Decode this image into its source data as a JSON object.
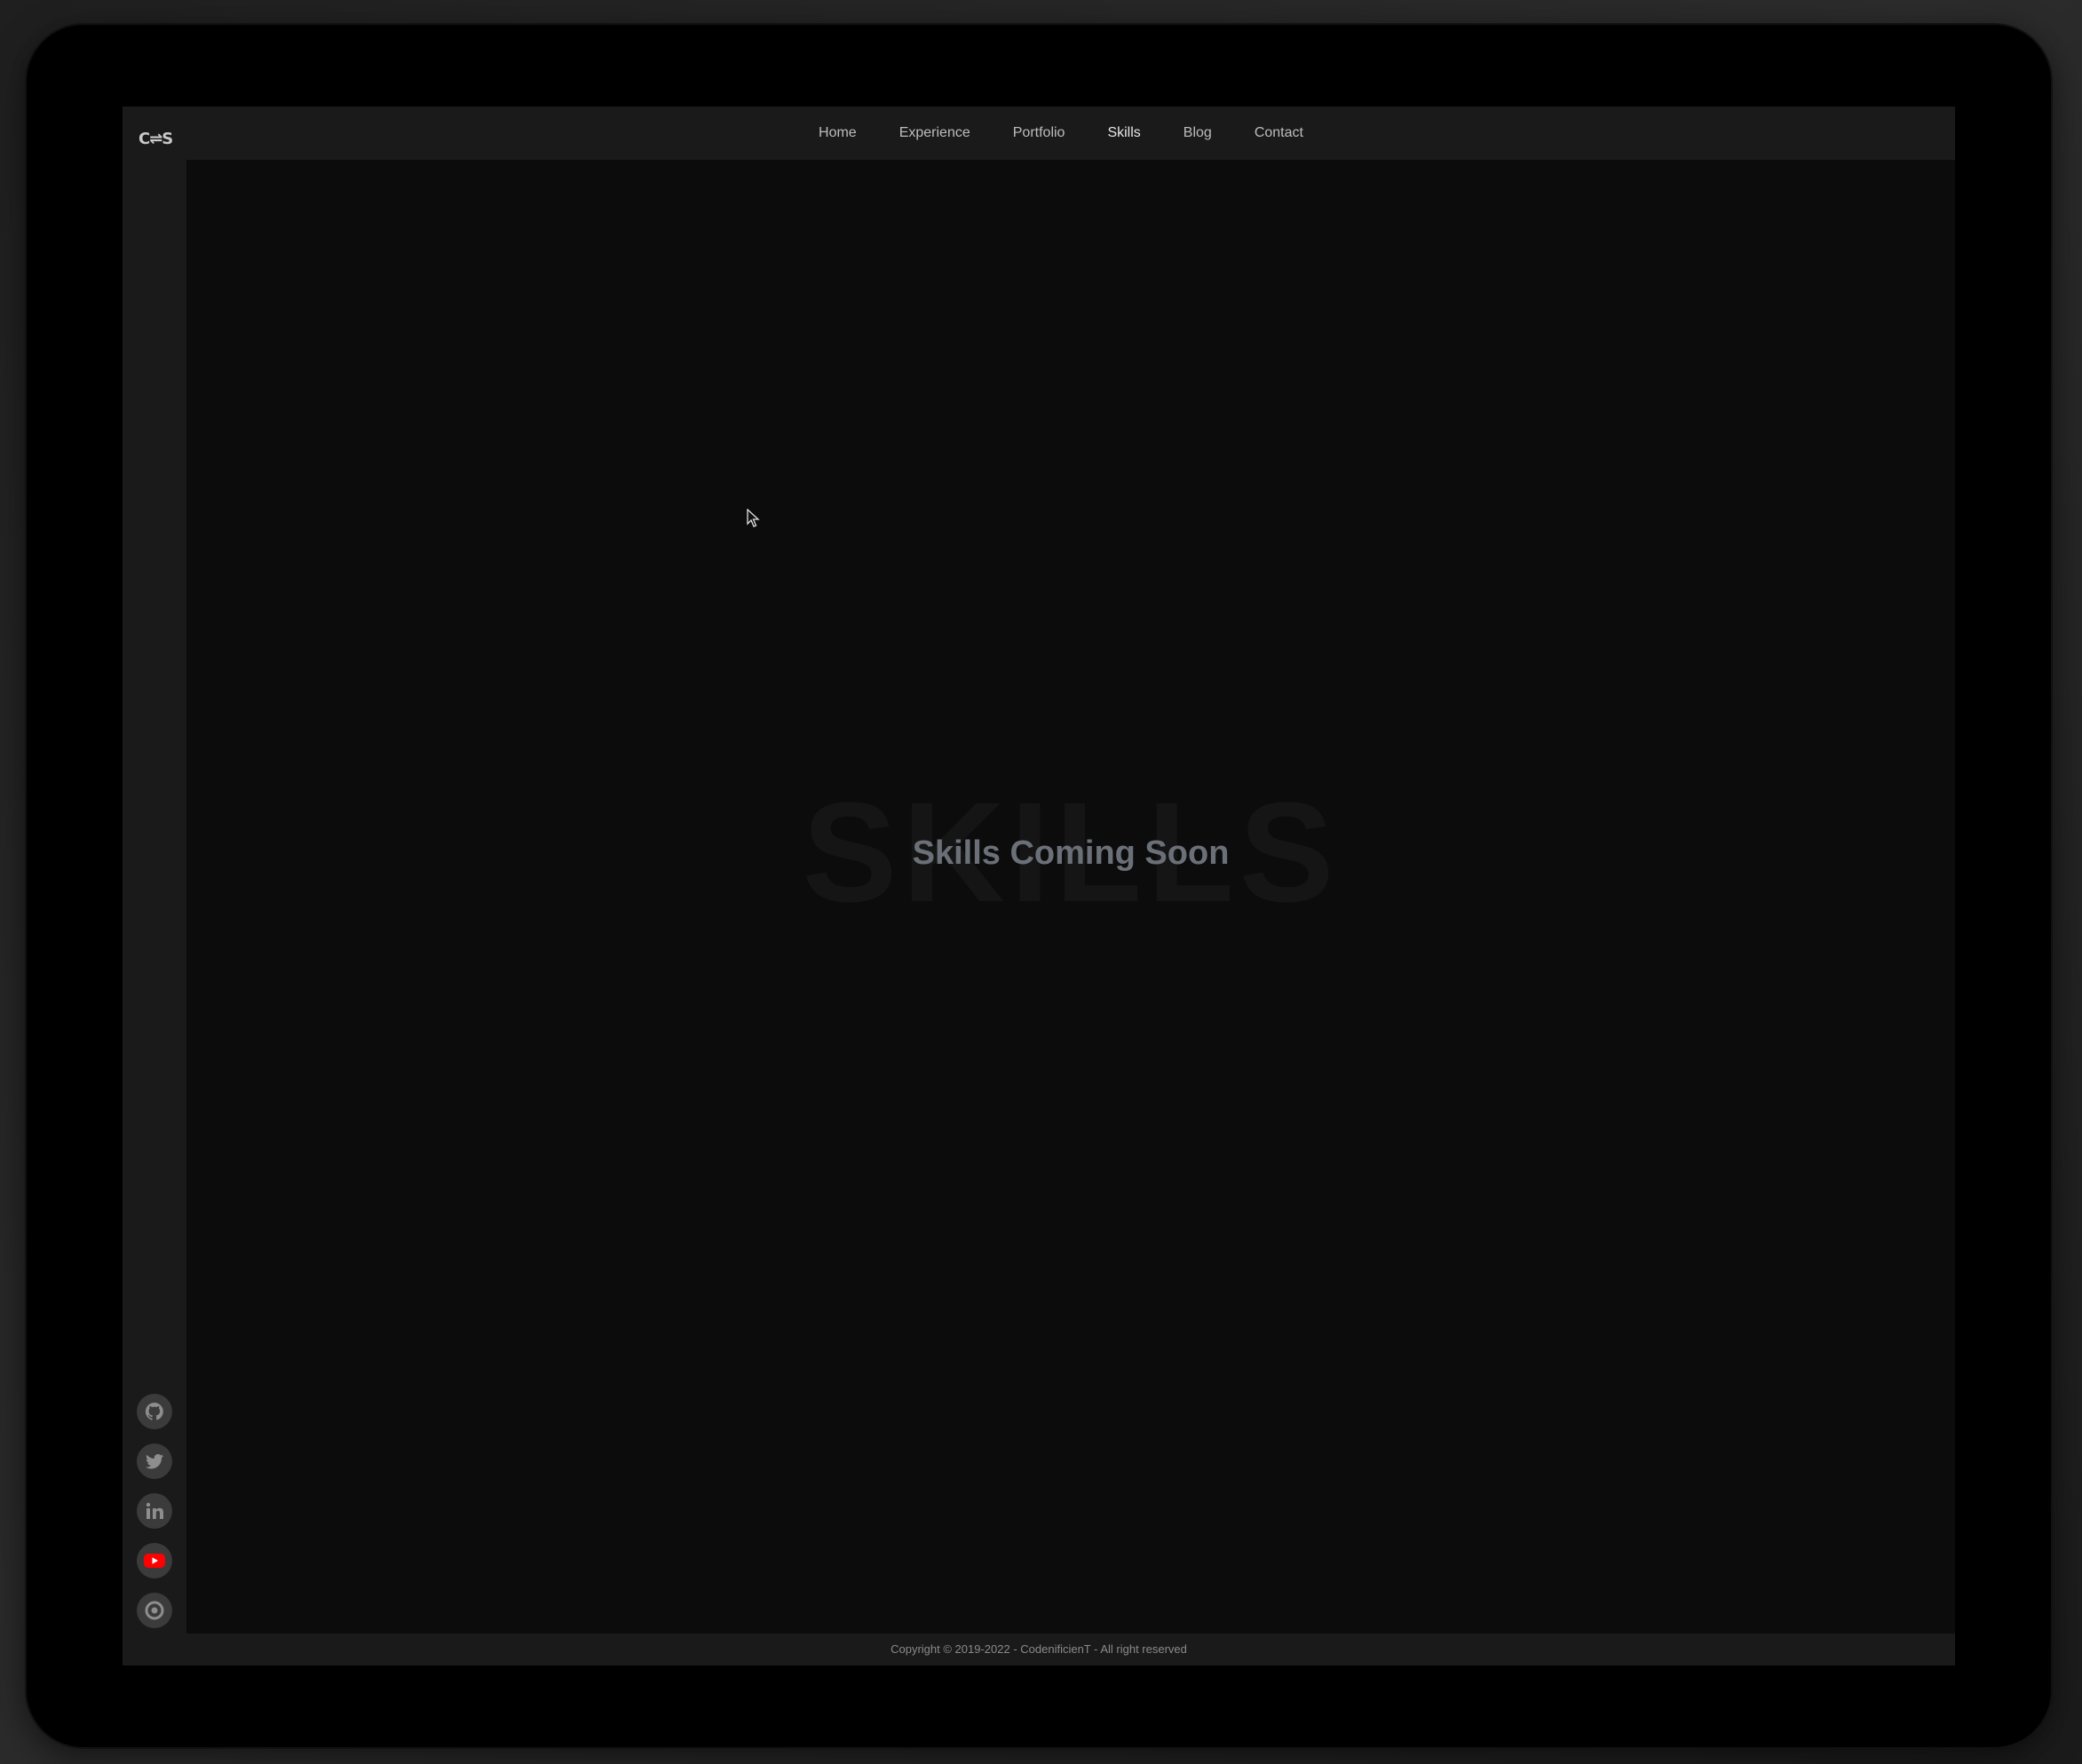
{
  "brand": {
    "logo_text": "C⇌S"
  },
  "nav": {
    "items": [
      {
        "label": "Home"
      },
      {
        "label": "Experience"
      },
      {
        "label": "Portfolio"
      },
      {
        "label": "Skills",
        "active": true
      },
      {
        "label": "Blog"
      },
      {
        "label": "Contact"
      }
    ]
  },
  "sidebar": {
    "socials": [
      {
        "icon": "github-icon"
      },
      {
        "icon": "twitter-icon"
      },
      {
        "icon": "linkedin-icon"
      },
      {
        "icon": "youtube-icon",
        "color": "#ff0000"
      },
      {
        "icon": "target-icon"
      }
    ]
  },
  "main": {
    "watermark": "SKILLS",
    "headline": "Skills Coming Soon"
  },
  "footer": {
    "copyright": "Copyright © 2019-2022 - CodenificienT - All right reserved"
  }
}
